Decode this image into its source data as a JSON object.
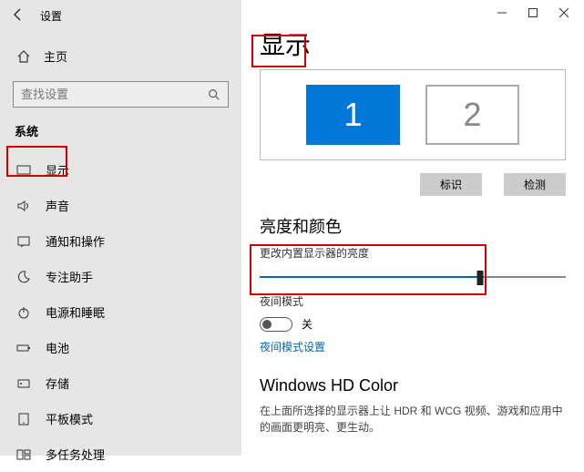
{
  "sidebar": {
    "appTitle": "设置",
    "home": "主页",
    "searchPlaceholder": "查找设置",
    "section": "系统",
    "items": [
      {
        "label": "显示"
      },
      {
        "label": "声音"
      },
      {
        "label": "通知和操作"
      },
      {
        "label": "专注助手"
      },
      {
        "label": "电源和睡眠"
      },
      {
        "label": "电池"
      },
      {
        "label": "存储"
      },
      {
        "label": "平板模式"
      },
      {
        "label": "多任务处理"
      }
    ]
  },
  "main": {
    "title": "显示",
    "monitor1": "1",
    "monitor2": "2",
    "identifyBtn": "标识",
    "detectBtn": "检测",
    "brightnessSection": "亮度和颜色",
    "brightnessLabel": "更改内置显示器的亮度",
    "nightLightLabel": "夜间模式",
    "toggleOff": "关",
    "nightLightLink": "夜间模式设置",
    "hdTitle": "Windows HD Color",
    "hdDesc": "在上面所选择的显示器上让 HDR 和 WCG 视频、游戏和应用中的画面更明亮、更生动。"
  }
}
